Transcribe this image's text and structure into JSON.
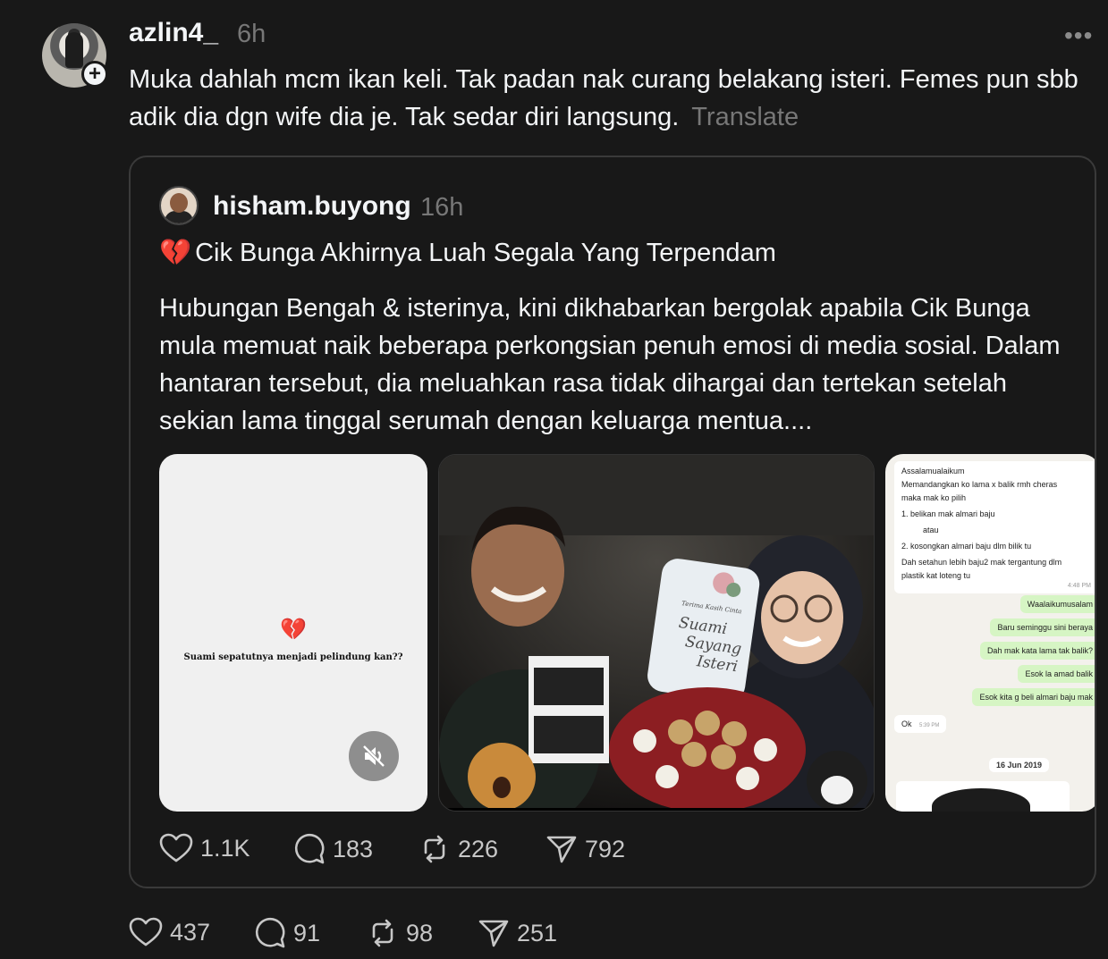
{
  "post": {
    "username": "azlin4_",
    "time": "6h",
    "more_label": "•••",
    "caption": "Muka dahlah mcm ikan keli. Tak padan nak curang belakang isteri. Femes pun sbb adik dia dgn wife dia je. Tak sedar diri langsung.",
    "translate_label": "Translate",
    "follow_label": "+",
    "stats": {
      "likes": "437",
      "replies": "91",
      "reposts": "98",
      "shares": "251"
    }
  },
  "quote": {
    "username": "hisham.buyong",
    "time": "16h",
    "title_emoji": "💔",
    "title": "Cik Bunga Akhirnya Luah Segala Yang Terpendam",
    "body": "Hubungan Bengah & isterinya, kini dikhabarkan bergolak apabila Cik Bunga mula memuat naik beberapa perkongsian penuh emosi di media sosial. Dalam hantaran tersebut, dia meluahkan rasa tidak dihargai dan tertekan setelah sekian lama tinggal serumah dengan keluarga mentua....",
    "media": {
      "video_heart": "💔",
      "video_text": "Suami sepatutnya menjadi pelindung kan??",
      "card_script": [
        "Terima Kasih Cinta",
        "Suami",
        "Sayang",
        "Isteri"
      ],
      "chat_lines": [
        "Assalamualaikum",
        "Memandangkan ko lama x balik rmh cheras",
        "maka mak ko pilih",
        "1. belikan mak almari baju",
        "atau",
        "2. kosongkan almari baju dlm bilik tu",
        "Dah setahun lebih baju2 mak tergantung dlm",
        "plastik kat loteng tu"
      ],
      "chat_time": "4:48 PM",
      "replies": [
        "Waalaikumusalam",
        "Baru seminggu sini beraya",
        "Dah mak kata lama tak balik?",
        "Esok la amad balik",
        "Esok kita g beli almari baju mak"
      ],
      "ok_text": "Ok",
      "ok_time": "5:39 PM",
      "date_chip": "16 Jun 2019"
    },
    "stats": {
      "likes": "1.1K",
      "replies": "183",
      "reposts": "226",
      "shares": "792"
    }
  }
}
